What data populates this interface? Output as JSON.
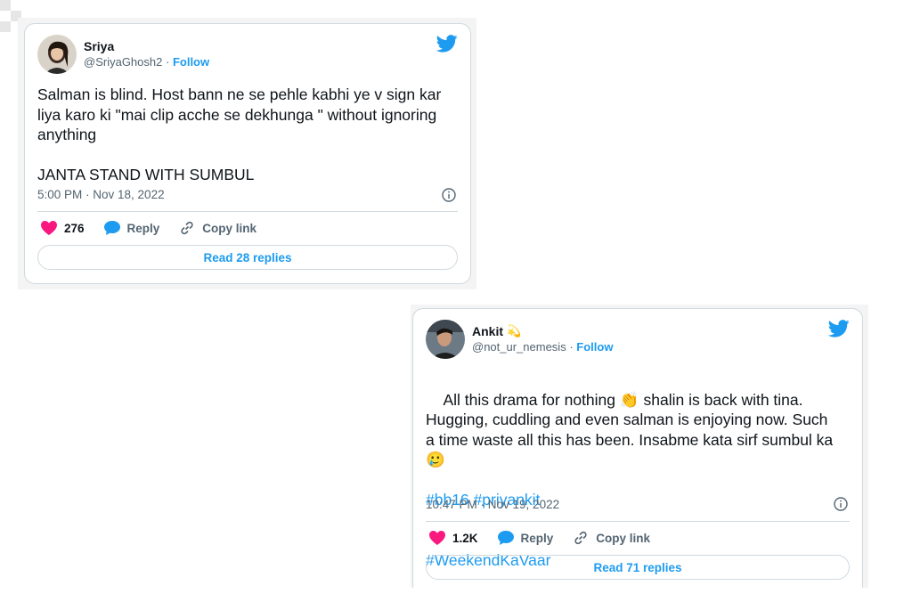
{
  "tweets": [
    {
      "name": "Sriya",
      "handle": "@SriyaGhosh2",
      "separator": "·",
      "follow_label": "Follow",
      "text": "Salman is blind. Host bann ne se pehle kabhi ye v sign kar\nliya karo ki \"mai clip acche se dekhunga \" without ignoring\nanything\n\nJANTA STAND WITH SUMBUL",
      "hashtags": [],
      "timestamp": "5:00 PM · Nov 18, 2022",
      "likes": "276",
      "reply_label": "Reply",
      "copy_label": "Copy link",
      "read_replies": "Read 28 replies"
    },
    {
      "name": "Ankit",
      "name_emoji": "💫",
      "handle": "@not_ur_nemesis",
      "separator": "·",
      "follow_label": "Follow",
      "text": "All this drama for nothing 👏 shalin is back with tina.\nHugging, cuddling and even salman is enjoying now. Such\na time waste all this has been. Insabme kata sirf sumbul ka\n🥲",
      "hashtags": [
        "#bb16 #priyankit",
        "#WeekendKaVaar"
      ],
      "timestamp": "10:47 PM · Nov 19, 2022",
      "likes": "1.2K",
      "reply_label": "Reply",
      "copy_label": "Copy link",
      "read_replies": "Read 71 replies"
    }
  ],
  "colors": {
    "accent": "#1d9bf0",
    "like": "#f91880",
    "text": "#0f1419",
    "muted": "#536471",
    "border": "#cfd9de"
  },
  "icons": [
    "twitter-bird-icon",
    "heart-icon",
    "reply-bubble-icon",
    "link-icon",
    "info-icon"
  ]
}
